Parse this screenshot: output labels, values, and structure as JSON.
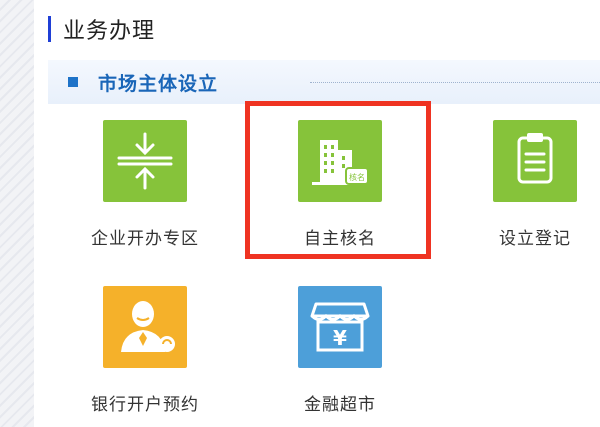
{
  "page": {
    "title": "业务办理",
    "section_title": "市场主体设立"
  },
  "colors": {
    "accent_blue": "#1e73c8",
    "title_bar": "#1f3fd6",
    "tile_green": "#86c33a",
    "tile_orange": "#f5b12a",
    "tile_blue": "#4d9fd9",
    "highlight_red": "#ef3322"
  },
  "tiles": [
    {
      "label": "企业开办专区",
      "icon": "compress-arrows-icon",
      "color": "green"
    },
    {
      "label": "自主核名",
      "icon": "building-name-check-icon",
      "color": "green",
      "badge": "核名"
    },
    {
      "label": "设立登记",
      "icon": "clipboard-icon",
      "color": "green"
    },
    {
      "label": "银行开户预约",
      "icon": "bank-clerk-icon",
      "color": "orange"
    },
    {
      "label": "金融超市",
      "icon": "finance-shop-icon",
      "color": "blue",
      "symbol": "¥"
    }
  ]
}
